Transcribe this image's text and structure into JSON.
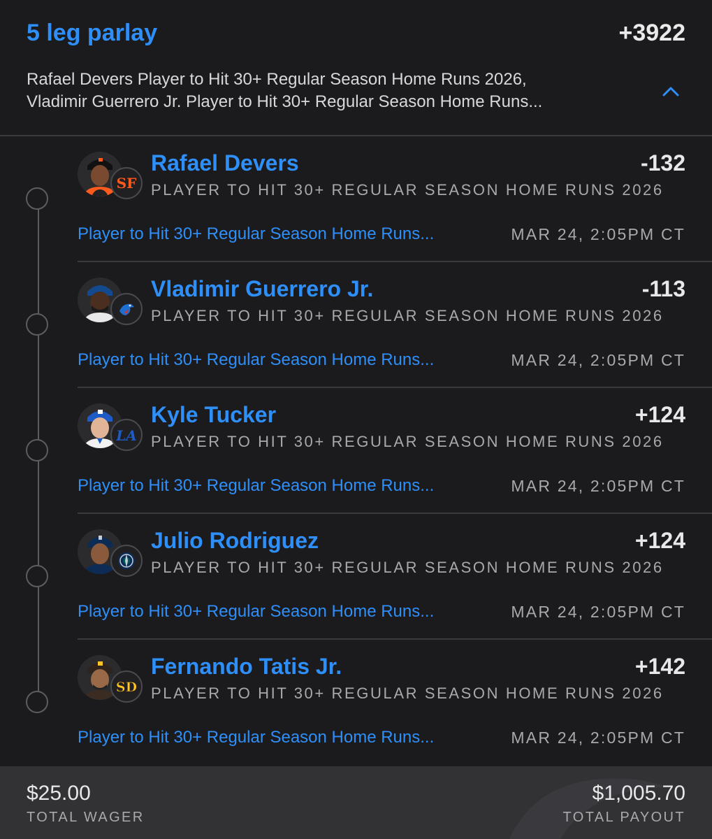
{
  "parlay": {
    "title": "5 leg parlay",
    "odds": "+3922",
    "summary_line1": "Rafael Devers Player to Hit 30+ Regular Season Home Runs 2026,",
    "summary_line2": "Vladimir Guerrero Jr. Player to Hit 30+ Regular Season Home Runs...",
    "expanded": true
  },
  "legs": [
    {
      "player": "Rafael Devers",
      "odds": "-132",
      "market": "PLAYER TO HIT 30+ REGULAR SEASON HOME RUNS 2026",
      "link": "Player to Hit 30+ Regular Season Home Runs...",
      "time": "MAR 24, 2:05PM CT",
      "team_icon": "giants-logo-icon",
      "team_color": "#fd5a1e"
    },
    {
      "player": "Vladimir Guerrero Jr.",
      "odds": "-113",
      "market": "PLAYER TO HIT 30+ REGULAR SEASON HOME RUNS 2026",
      "link": "Player to Hit 30+ Regular Season Home Runs...",
      "time": "MAR 24, 2:05PM CT",
      "team_icon": "blue-jays-logo-icon",
      "team_color": "#134a8e"
    },
    {
      "player": "Kyle Tucker",
      "odds": "+124",
      "market": "PLAYER TO HIT 30+ REGULAR SEASON HOME RUNS 2026",
      "link": "Player to Hit 30+ Regular Season Home Runs...",
      "time": "MAR 24, 2:05PM CT",
      "team_icon": "dodgers-logo-icon",
      "team_color": "#1e5bc6"
    },
    {
      "player": "Julio Rodriguez",
      "odds": "+124",
      "market": "PLAYER TO HIT 30+ REGULAR SEASON HOME RUNS 2026",
      "link": "Player to Hit 30+ Regular Season Home Runs...",
      "time": "MAR 24, 2:05PM CT",
      "team_icon": "mariners-logo-icon",
      "team_color": "#005c5c"
    },
    {
      "player": "Fernando Tatis Jr.",
      "odds": "+142",
      "market": "PLAYER TO HIT 30+ REGULAR SEASON HOME RUNS 2026",
      "link": "Player to Hit 30+ Regular Season Home Runs...",
      "time": "MAR 24, 2:05PM CT",
      "team_icon": "padres-logo-icon",
      "team_color": "#ffc425"
    }
  ],
  "footer": {
    "wager_amount": "$25.00",
    "wager_label": "TOTAL WAGER",
    "payout_amount": "$1,005.70",
    "payout_label": "TOTAL PAYOUT"
  },
  "colors": {
    "accent": "#2f8ff8",
    "background": "#1b1b1d",
    "footer": "#323235"
  }
}
